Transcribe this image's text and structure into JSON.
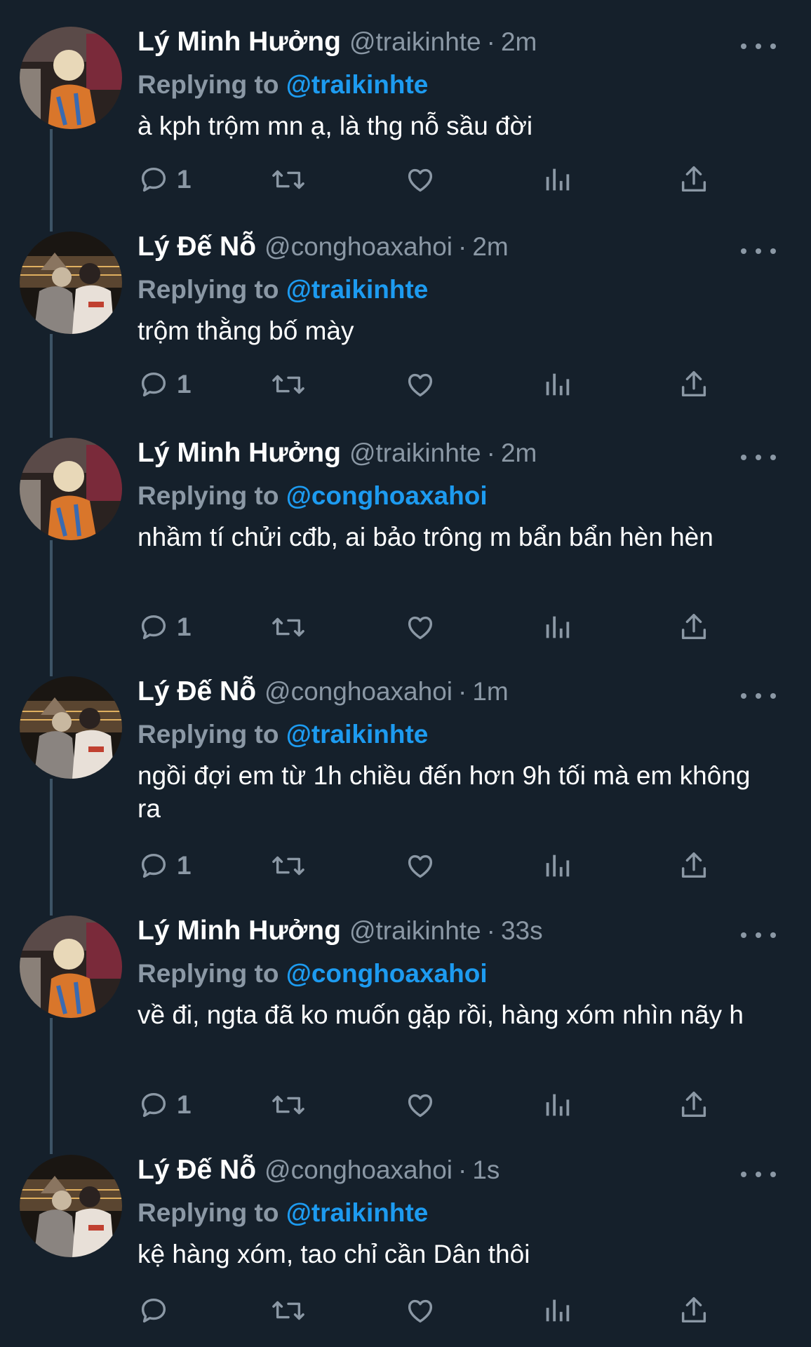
{
  "thread": {
    "tweets": [
      {
        "display_name": "Lý Minh Hưởng",
        "handle": "@traikinhte",
        "time": "2m",
        "replying_prefix": "Replying to ",
        "replying_to": "@traikinhte",
        "text": "à kph trộm mn ạ, là thg nỗ sầu đời",
        "reply_count": "1",
        "avatar": "avatar-a"
      },
      {
        "display_name": "Lý Đế Nỗ",
        "handle": "@conghoaxahoi",
        "time": "2m",
        "replying_prefix": "Replying to ",
        "replying_to": "@traikinhte",
        "text": "trộm thằng bố mày",
        "reply_count": "1",
        "avatar": "avatar-b"
      },
      {
        "display_name": "Lý Minh Hưởng",
        "handle": "@traikinhte",
        "time": "2m",
        "replying_prefix": "Replying to ",
        "replying_to": "@conghoaxahoi",
        "text": "nhầm tí chửi cđb, ai bảo trông m bẩn bẩn hèn hèn",
        "reply_count": "1",
        "avatar": "avatar-a"
      },
      {
        "display_name": "Lý Đế Nỗ",
        "handle": "@conghoaxahoi",
        "time": "1m",
        "replying_prefix": "Replying to ",
        "replying_to": "@traikinhte",
        "text": "ngồi đợi em từ 1h chiều đến hơn 9h tối mà em không ra",
        "reply_count": "1",
        "avatar": "avatar-b"
      },
      {
        "display_name": "Lý Minh Hưởng",
        "handle": "@traikinhte",
        "time": "33s",
        "replying_prefix": "Replying to ",
        "replying_to": "@conghoaxahoi",
        "text": "về đi, ngta đã ko muốn gặp rồi, hàng xóm nhìn nãy h",
        "reply_count": "1",
        "avatar": "avatar-a"
      },
      {
        "display_name": "Lý Đế Nỗ",
        "handle": "@conghoaxahoi",
        "time": "1s",
        "replying_prefix": "Replying to ",
        "replying_to": "@traikinhte",
        "text": "kệ hàng xóm, tao chỉ cần Dân thôi",
        "reply_count": "",
        "avatar": "avatar-b"
      }
    ],
    "separator": "·"
  },
  "icons": {
    "reply": "reply-icon",
    "retweet": "retweet-icon",
    "like": "like-icon",
    "views": "views-icon",
    "share": "share-icon",
    "more": "more-icon"
  },
  "colors": {
    "background": "#15202b",
    "text_primary": "#ffffff",
    "text_secondary": "#8b98a5",
    "link": "#1d9bf0",
    "thread_line": "#3d5466"
  }
}
